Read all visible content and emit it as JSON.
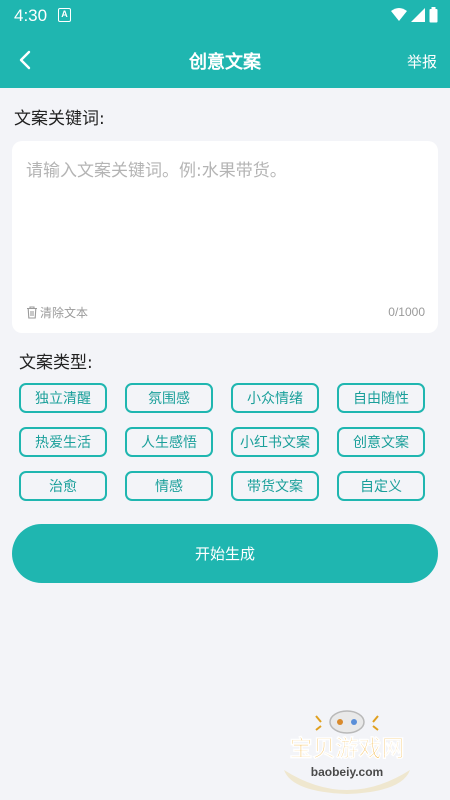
{
  "status_bar": {
    "time": "4:30",
    "notification_letter": "A"
  },
  "header": {
    "title": "创意文案",
    "report_label": "举报"
  },
  "keywords": {
    "label": "文案关键词:",
    "placeholder": "请输入文案关键词。例:水果带货。",
    "clear_label": "清除文本",
    "counter": "0/1000"
  },
  "types": {
    "label": "文案类型:",
    "tags": [
      "独立清醒",
      "氛围感",
      "小众情绪",
      "自由随性",
      "热爱生活",
      "人生感悟",
      "小红书文案",
      "创意文案",
      "治愈",
      "情感",
      "带货文案",
      "自定义"
    ]
  },
  "generate_label": "开始生成",
  "watermark": {
    "title": "宝贝游戏网",
    "url": "baobeiy.com"
  }
}
